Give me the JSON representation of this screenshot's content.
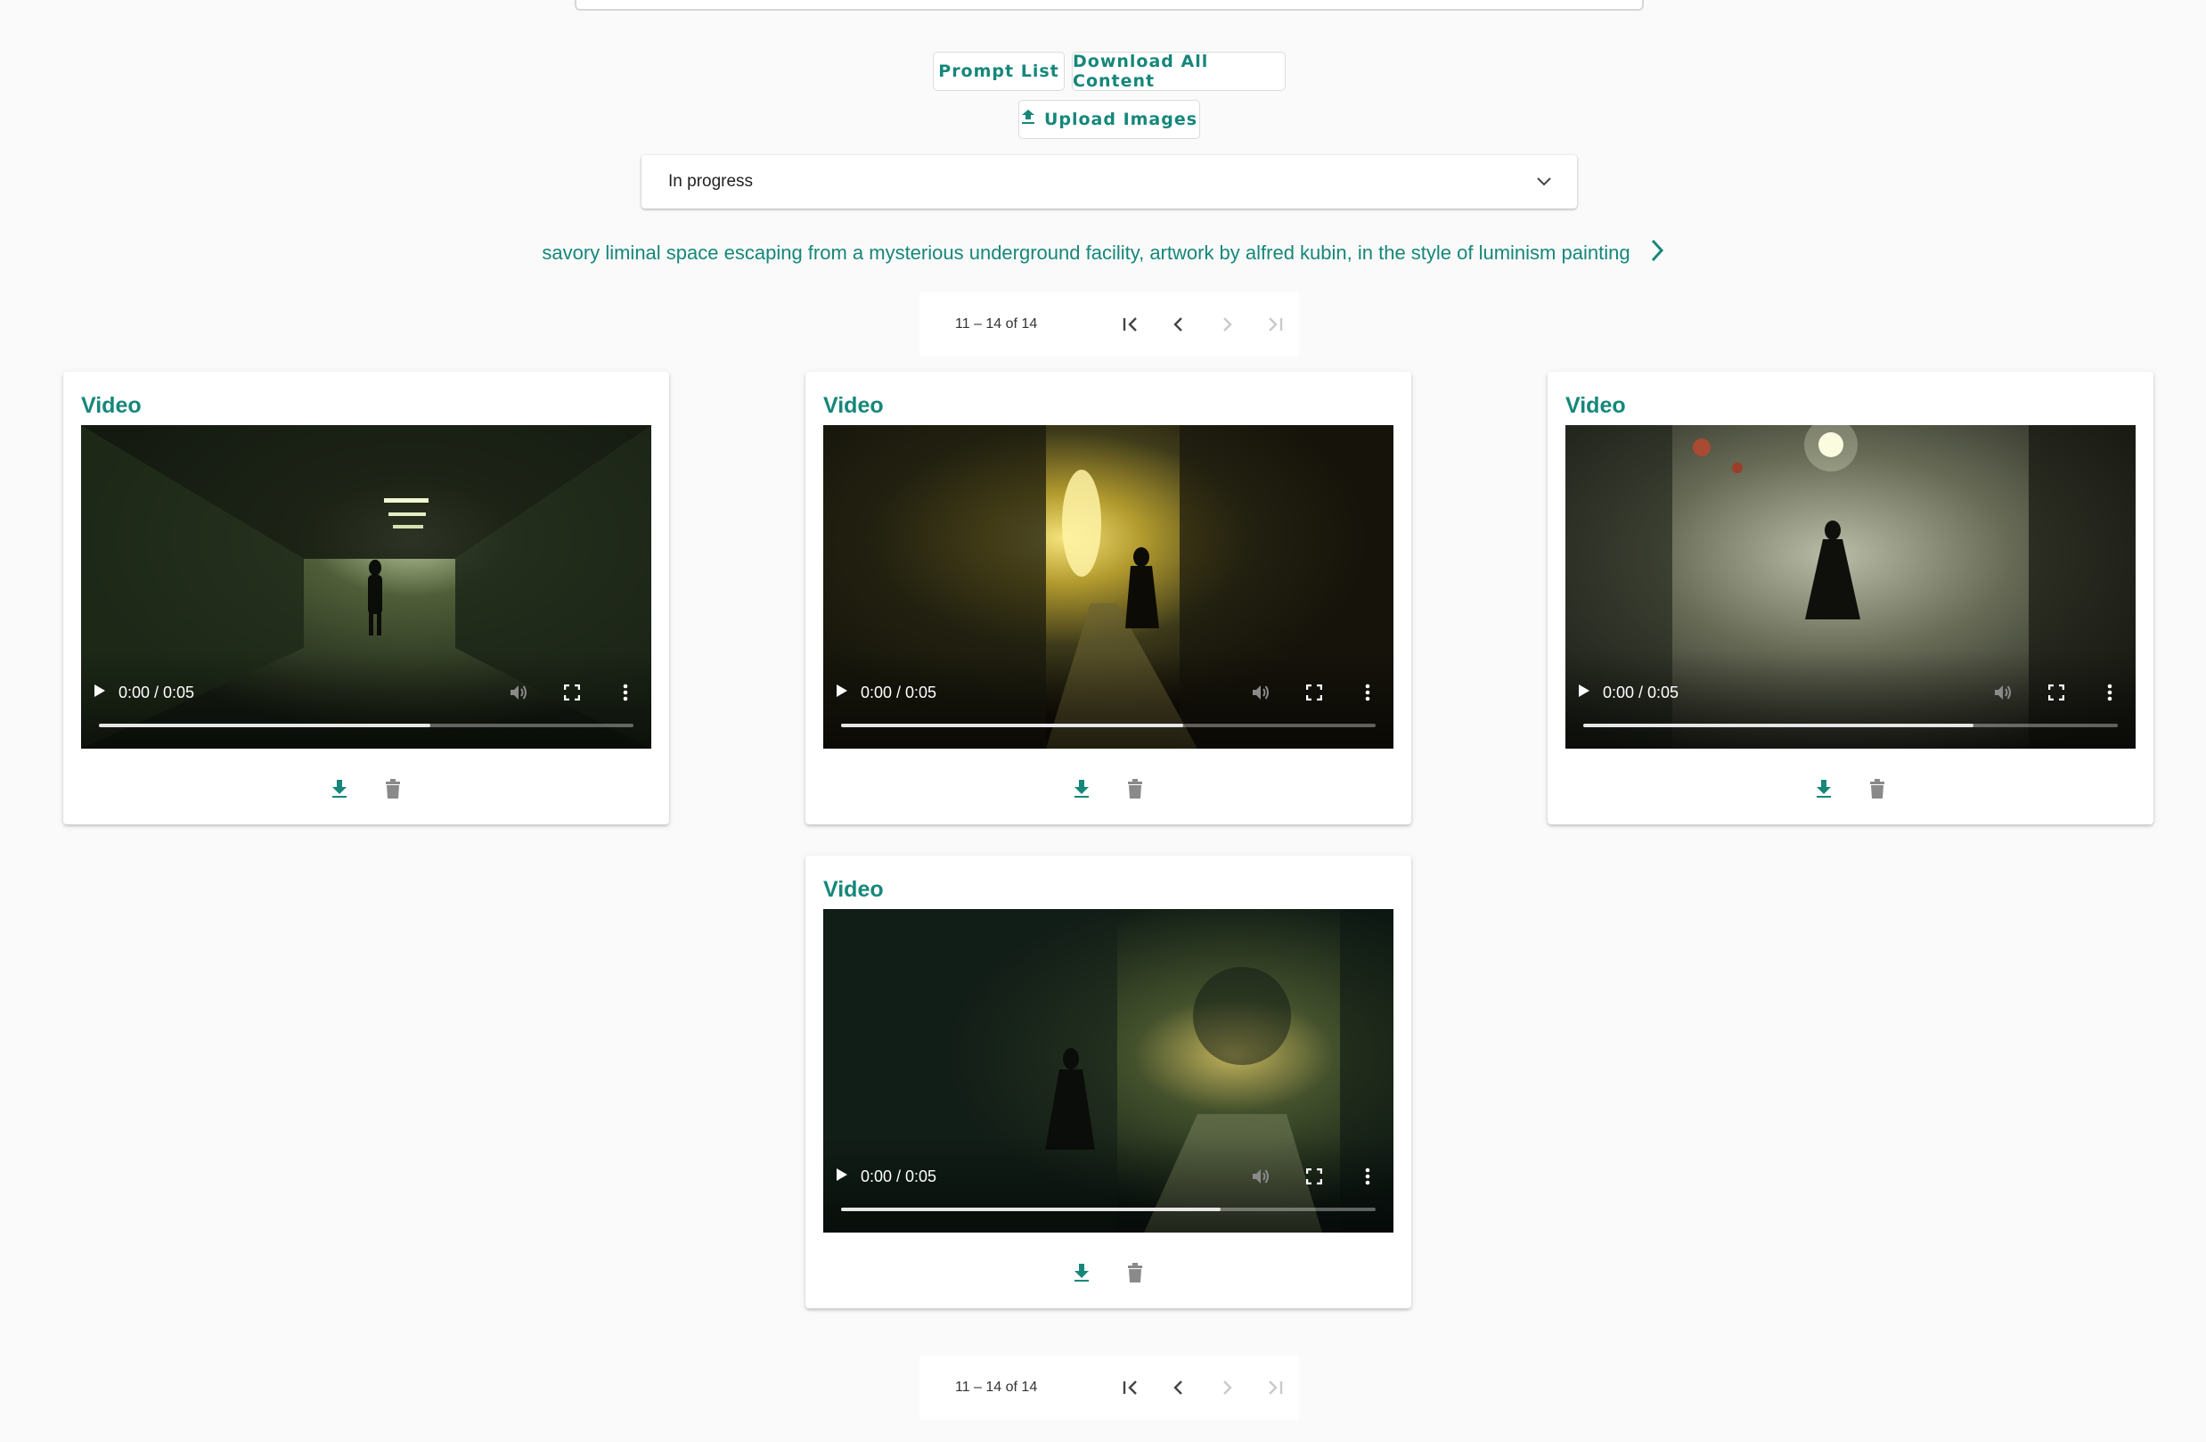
{
  "toolbar": {
    "prompt_list_label": "Prompt List",
    "download_all_label": "Download All Content",
    "upload_images_label": "Upload Images"
  },
  "status_select": {
    "value": "In progress"
  },
  "prompt": {
    "text": "savory liminal space escaping from a mysterious underground facility, artwork by alfred kubin, in the style of luminism painting"
  },
  "paginator_top": {
    "range": "11 – 14 of 14"
  },
  "paginator_bottom": {
    "range": "11 – 14 of 14"
  },
  "cards": [
    {
      "title": "Video",
      "time": "0:00 / 0:05",
      "progress": 0.62
    },
    {
      "title": "Video",
      "time": "0:00 / 0:05",
      "progress": 0.64
    },
    {
      "title": "Video",
      "time": "0:00 / 0:05",
      "progress": 0.73
    },
    {
      "title": "Video",
      "time": "0:00 / 0:05",
      "progress": 0.71
    }
  ],
  "colors": {
    "accent": "#16877a",
    "background": "#fafafa",
    "icon_gray": "#8a8a8a"
  },
  "icons": [
    "upload-icon",
    "chevron-down-icon",
    "chevron-right-icon",
    "first-page-icon",
    "previous-page-icon",
    "next-page-icon",
    "last-page-icon",
    "play-icon",
    "volume-icon",
    "fullscreen-icon",
    "more-vert-icon",
    "download-icon",
    "delete-icon"
  ]
}
